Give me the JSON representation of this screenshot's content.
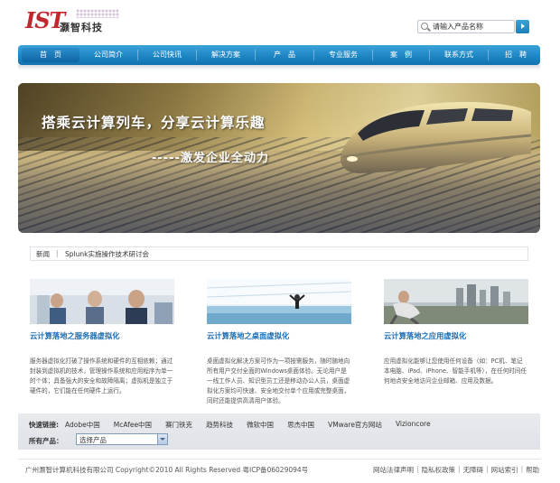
{
  "header": {
    "logo_mark": "IST",
    "logo_text": "灏智科技",
    "search_placeholder": "请输入产品名称"
  },
  "nav": {
    "items": [
      {
        "label": "首　页",
        "active": true
      },
      {
        "label": "公司简介"
      },
      {
        "label": "公司快讯"
      },
      {
        "label": "解决方案"
      },
      {
        "label": "产　品"
      },
      {
        "label": "专业服务"
      },
      {
        "label": "案　例"
      },
      {
        "label": "联系方式"
      },
      {
        "label": "招　聘"
      }
    ]
  },
  "banner": {
    "slogan_main": "搭乘云计算列车，分享云计算乐趣",
    "slogan_sub": "-----激发企业全动力"
  },
  "news": {
    "label": "新闻",
    "separator": "|",
    "item": "Splunk实施操作技术研讨会"
  },
  "features": [
    {
      "title": "云计算落地之服务器虚拟化",
      "text": "服务器虚拟化打破了操作系统和硬件的互相依赖；通过封装到虚拟机的技术，管理操作系统和应用程序为单一的个体；具备强大的安全和故障隔离；虚拟机是独立于硬件的，它们能在任何硬件上运行。"
    },
    {
      "title": "云计算落地之桌面虚拟化",
      "text": "桌面虚拟化解决方案可作为一项按需服务，随时随地向所有用户交付全面的Windows桌面体验。无论用户是一线工作人员、知识型员工还是移动办公人员，桌面虚拟化方案均可快速、安全地交付单个应用或完整桌面，同时还能提供高清用户体验。"
    },
    {
      "title": "云计算落地之应用虚拟化",
      "text": "应用虚拟化能够让您使用任何设备（如：PC机、笔记本电脑、iPad、iPhone、智能手机等），在任何时间任何地点安全地访问企业邮箱、应用及数据。"
    }
  ],
  "links": {
    "label": "快速链接:",
    "items": [
      "Adobe中国",
      "McAfee中国",
      "赛门铁克",
      "趋势科技",
      "微软中国",
      "思杰中国",
      "VMware官方网站",
      "Vizioncore"
    ],
    "product_label": "所有产品：",
    "product_selected": "选择产品"
  },
  "footer": {
    "copyright": "广州灏智计算机科技有限公司 Copyright©2010 All Rights Reserved 粤ICP备06029094号",
    "links": [
      "网站法律声明",
      "隐私权政策",
      "无障碍",
      "网站索引",
      "帮助"
    ],
    "sep": "|"
  },
  "colors": {
    "nav_blue": "#1e86c4",
    "title_blue": "#1e6fb3",
    "logo_red": "#c0282d"
  }
}
